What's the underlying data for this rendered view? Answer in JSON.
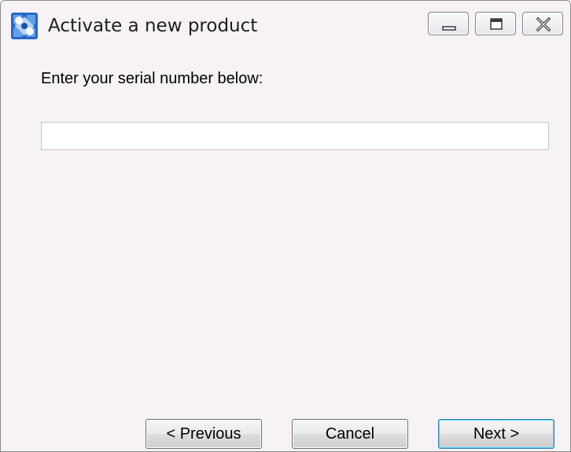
{
  "window": {
    "title": "Activate a new product",
    "app_icon": "puzzle-app-icon",
    "controls": {
      "minimize_icon": "minimize-icon",
      "maximize_icon": "maximize-icon",
      "close_icon": "close-icon"
    }
  },
  "form": {
    "prompt": "Enter your serial number below:",
    "serial_value": "",
    "serial_placeholder": ""
  },
  "buttons": {
    "previous_label": "< Previous",
    "cancel_label": "Cancel",
    "next_label": "Next >"
  },
  "colors": {
    "window_background": "#f6f2f6",
    "default_button_border": "#3c7fb1",
    "app_icon_blue": "#2a66c8"
  }
}
